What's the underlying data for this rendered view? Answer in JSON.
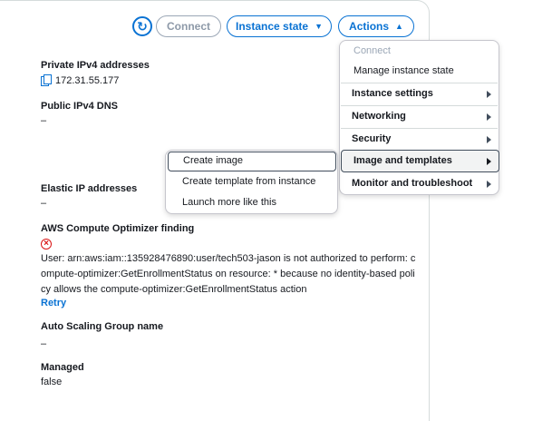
{
  "toolbar": {
    "refresh_icon": "refresh-icon",
    "connect_label": "Connect",
    "instance_state_label": "Instance state",
    "actions_label": "Actions"
  },
  "details": {
    "private_ipv4": {
      "label": "Private IPv4 addresses",
      "value": "172.31.55.177"
    },
    "public_dns": {
      "label": "Public IPv4 DNS",
      "value": "–"
    },
    "elastic_ip": {
      "label": "Elastic IP addresses",
      "value": "–"
    },
    "optimizer": {
      "label": "AWS Compute Optimizer finding",
      "message": "User: arn:aws:iam::135928476890:user/tech503-jason is not authorized to perform: compute-optimizer:GetEnrollmentStatus on resource: * because no identity-based policy allows the compute-optimizer:GetEnrollmentStatus action",
      "retry_label": "Retry"
    },
    "asg": {
      "label": "Auto Scaling Group name",
      "value": "–"
    },
    "managed": {
      "label": "Managed",
      "value": "false"
    }
  },
  "actions_menu": {
    "connect": "Connect",
    "manage_state": "Manage instance state",
    "instance_settings": "Instance settings",
    "networking": "Networking",
    "security": "Security",
    "image_templates": "Image and templates",
    "monitor": "Monitor and troubleshoot"
  },
  "image_submenu": {
    "create_image": "Create image",
    "create_template": "Create template from instance",
    "launch_more": "Launch more like this"
  },
  "colors": {
    "accent": "#0972d3",
    "error": "#d91515"
  }
}
